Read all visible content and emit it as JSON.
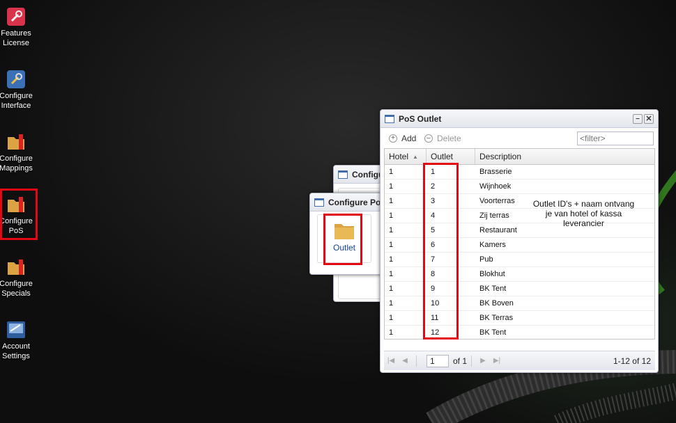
{
  "desktop": {
    "icons": [
      {
        "label": "Features License",
        "icon": "wrench-icon"
      },
      {
        "label": "Configure Interface",
        "icon": "wrench-icon"
      },
      {
        "label": "Configure Mappings",
        "icon": "folder-icon"
      },
      {
        "label": "Configure PoS",
        "icon": "folder-icon"
      },
      {
        "label": "Configure Specials",
        "icon": "folder-icon"
      },
      {
        "label": "Account Settings",
        "icon": "settings-icon"
      }
    ]
  },
  "windows": {
    "back_title": "Configure",
    "config_pos": {
      "title": "Configure PoS",
      "item_label": "Outlet"
    },
    "pos_outlet": {
      "title": "PoS Outlet",
      "toolbar": {
        "add_label": "Add",
        "delete_label": "Delete",
        "filter_placeholder": "<filter>"
      },
      "columns": [
        "Hotel",
        "Outlet",
        "Description"
      ],
      "rows": [
        {
          "hotel": "1",
          "outlet": "1",
          "description": "Brasserie"
        },
        {
          "hotel": "1",
          "outlet": "2",
          "description": "Wijnhoek"
        },
        {
          "hotel": "1",
          "outlet": "3",
          "description": "Voorterras"
        },
        {
          "hotel": "1",
          "outlet": "4",
          "description": "Zij terras"
        },
        {
          "hotel": "1",
          "outlet": "5",
          "description": "Restaurant"
        },
        {
          "hotel": "1",
          "outlet": "6",
          "description": "Kamers"
        },
        {
          "hotel": "1",
          "outlet": "7",
          "description": "Pub"
        },
        {
          "hotel": "1",
          "outlet": "8",
          "description": "Blokhut"
        },
        {
          "hotel": "1",
          "outlet": "9",
          "description": "BK Tent"
        },
        {
          "hotel": "1",
          "outlet": "10",
          "description": "BK Boven"
        },
        {
          "hotel": "1",
          "outlet": "11",
          "description": "BK Terras"
        },
        {
          "hotel": "1",
          "outlet": "12",
          "description": "BK Tent"
        }
      ],
      "pager": {
        "page": "1",
        "of_label": "of 1",
        "summary": "1-12 of 12"
      }
    }
  },
  "annotation": {
    "text_line1": "Outlet ID's + naam ontvang",
    "text_line2": "je van hotel of kassa",
    "text_line3": "leverancier"
  },
  "colors": {
    "highlight": "#e30613",
    "window_border": "#b5b8c8"
  }
}
